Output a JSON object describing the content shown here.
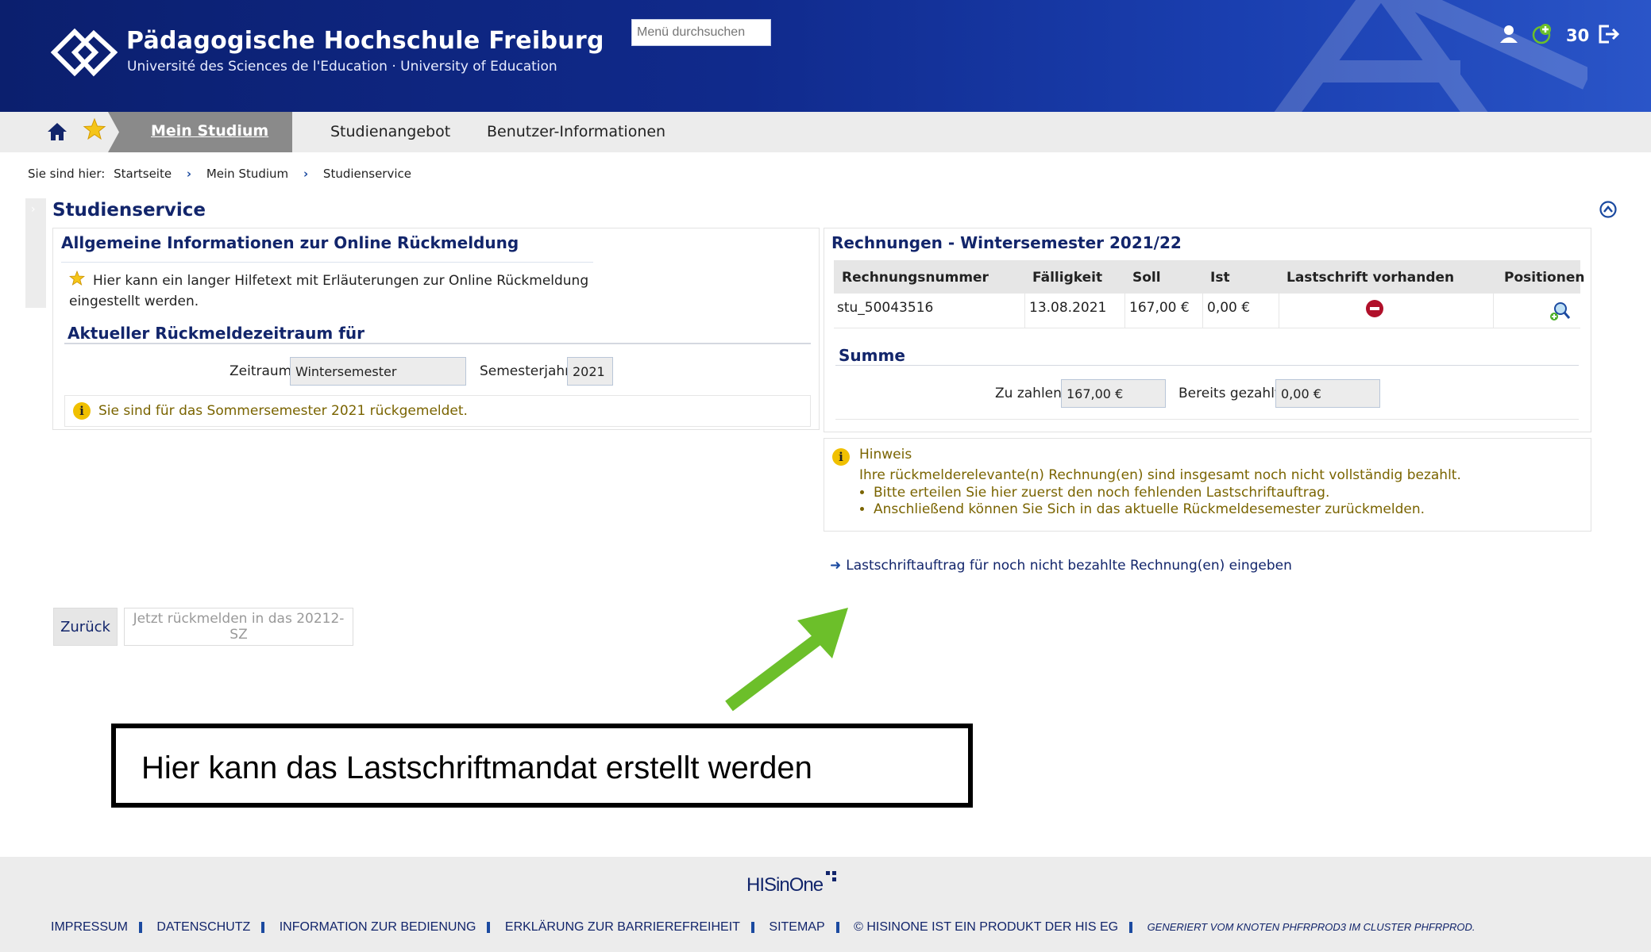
{
  "header": {
    "title": "Pädagogische Hochschule Freiburg",
    "subtitle": "Université des Sciences de l'Education · University of Education",
    "search_placeholder": "Menü durchsuchen",
    "count": "30"
  },
  "nav": {
    "active_tab": "Mein Studium",
    "tabs": [
      "Studienangebot",
      "Benutzer-Informationen"
    ]
  },
  "breadcrumb": {
    "prefix": "Sie sind hier:",
    "items": [
      "Startseite",
      "Mein Studium",
      "Studienservice"
    ]
  },
  "page_title": "Studienservice",
  "left_panel": {
    "heading": "Allgemeine Informationen zur Online Rückmeldung",
    "help_text": "Hier kann ein langer Hilfetext mit Erläuterungen zur Online Rückmeldung eingestellt werden.",
    "subheading": "Aktueller Rückmeldezeitraum für",
    "zeitraum_label": "Zeitraum",
    "zeitraum_value": "Wintersemester",
    "semesterjahr_label": "Semesterjahr",
    "semesterjahr_value": "2021",
    "info_text": "Sie sind für das Sommersemester 2021 rückgemeldet."
  },
  "right_panel": {
    "heading": "Rechnungen - Wintersemester 2021/22",
    "columns": [
      "Rechnungsnummer",
      "Fälligkeit",
      "Soll",
      "Ist",
      "Lastschrift vorhanden",
      "Positionen"
    ],
    "rows": [
      {
        "rechnungsnummer": "stu_50043516",
        "faelligkeit": "13.08.2021",
        "soll": "167,00 €",
        "ist": "0,00 €"
      }
    ],
    "summe_heading": "Summe",
    "zu_zahlen_label": "Zu zahlen",
    "zu_zahlen_value": "167,00 €",
    "bereits_label": "Bereits gezahlt",
    "bereits_value": "0,00 €"
  },
  "hint": {
    "title": "Hinweis",
    "text": "Ihre rückmelderelevante(n) Rechnung(en) sind insgesamt noch nicht vollständig bezahlt.",
    "items": [
      "Bitte erteilen Sie hier zuerst den noch fehlenden Lastschriftauftrag.",
      "Anschließend können Sie Sich in das aktuelle Rückmeldesemester zurückmelden."
    ]
  },
  "action_link": "Lastschriftauftrag für noch nicht bezahlte Rechnung(en) eingeben",
  "buttons": {
    "back": "Zurück",
    "register": "Jetzt rückmelden in das 20212-SZ"
  },
  "callout": "Hier kann das Lastschriftmandat erstellt werden",
  "footer": {
    "logo": "HISinOne",
    "links": [
      "IMPRESSUM",
      "DATENSCHUTZ",
      "INFORMATION ZUR BEDIENUNG",
      "ERKLÄRUNG ZUR BARRIEREFREIHEIT",
      "SITEMAP",
      "© HISINONE IST EIN PRODUKT DER HIS EG"
    ],
    "generated": "GENERIERT VOM KNOTEN PHFRPROD3 IM CLUSTER PHFRPROD."
  },
  "colors": {
    "header_blue": "#102a8c",
    "heading_navy": "#12256b",
    "hint_olive": "#7a6400",
    "arrow_green": "#6cbf2a",
    "error_red": "#b0102a"
  }
}
